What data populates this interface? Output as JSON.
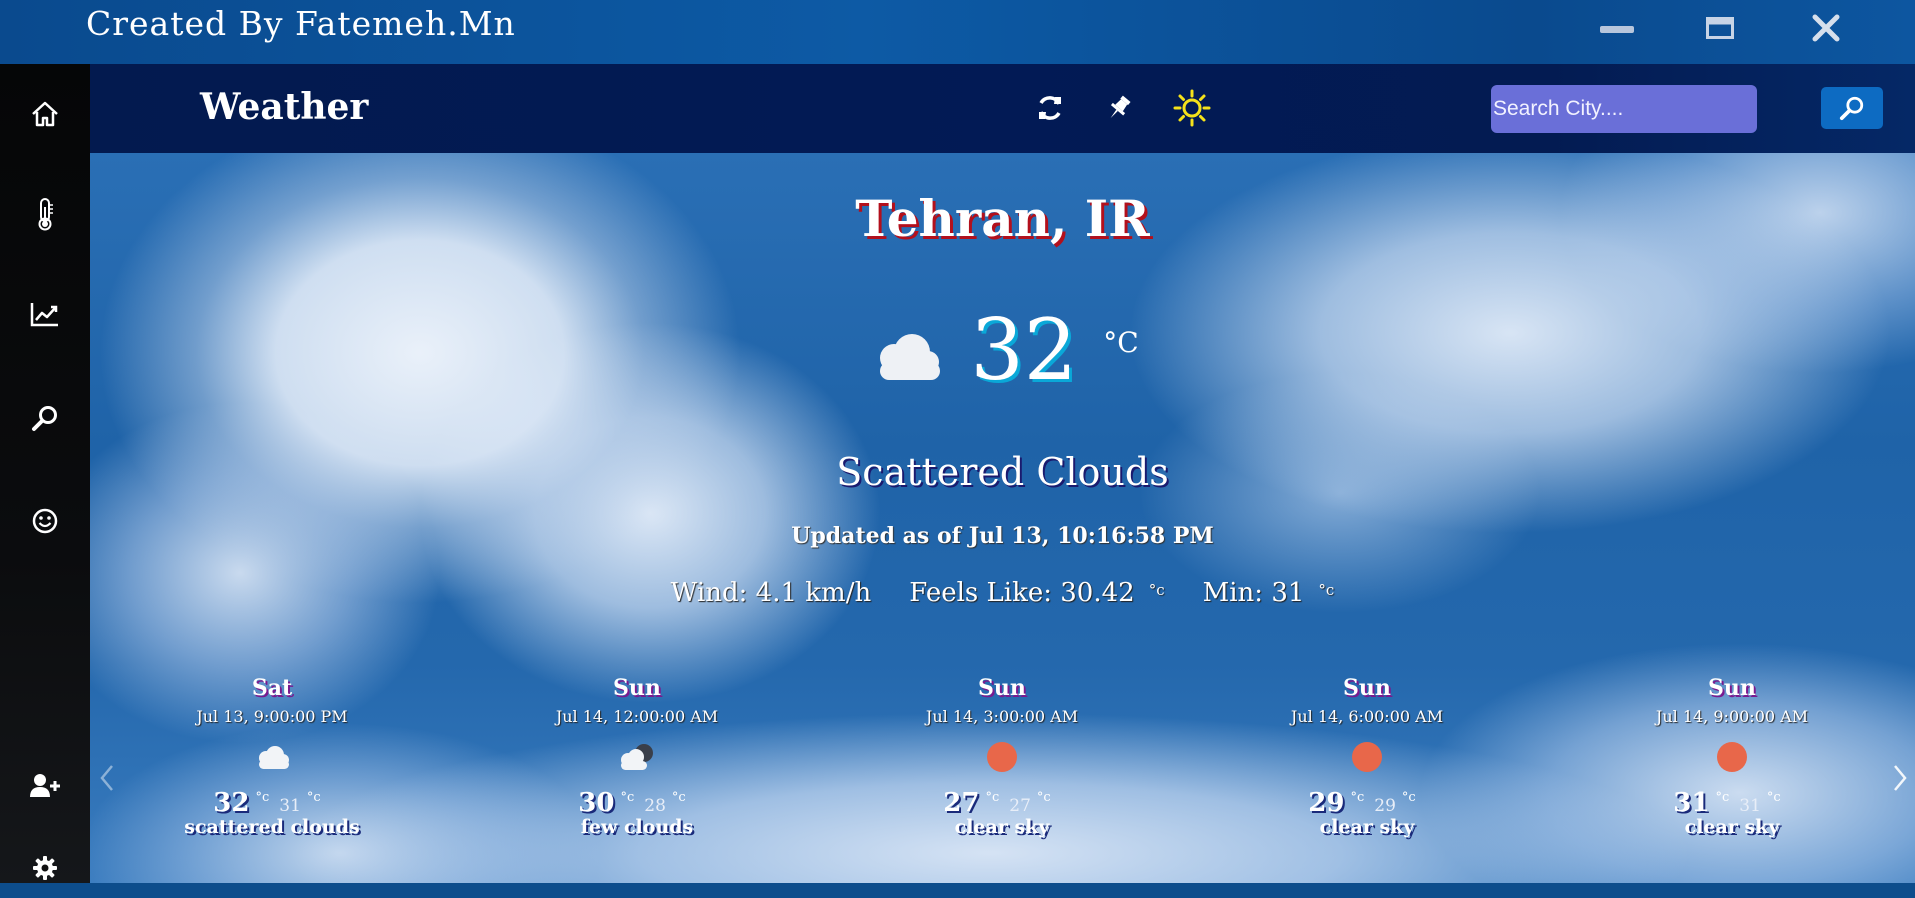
{
  "titlebar": {
    "title": "Created By Fatemeh.Mn",
    "buttons": [
      {
        "icon": "minimize-icon"
      },
      {
        "icon": "maximize-icon"
      },
      {
        "icon": "close-icon"
      }
    ]
  },
  "sidebar": {
    "items": [
      {
        "icon": "home-icon"
      },
      {
        "icon": "thermometer-icon"
      },
      {
        "icon": "chart-line-icon"
      },
      {
        "icon": "search-icon"
      },
      {
        "icon": "smile-icon"
      },
      {
        "icon": "user-plus-icon"
      },
      {
        "icon": "gear-icon"
      }
    ]
  },
  "header": {
    "brand": "Weather",
    "icons": [
      "refresh-icon",
      "pin-icon",
      "sun-icon"
    ],
    "search_placeholder": "Search City....",
    "search_button_icon": "search-icon",
    "colors": {
      "sun": "#f5e21a",
      "search_bg": "#6a6fd8",
      "search_button": "#0d6bc2"
    }
  },
  "current": {
    "city": "Tehran, IR",
    "temp": "32",
    "temp_unit": "°C",
    "icon": "cloud-icon",
    "description": "Scattered Clouds",
    "updated": "Updated as of Jul 13, 10:16:58 PM",
    "wind_label": "Wind: 4.1 km/h",
    "feels_label": "Feels Like: 30.42",
    "feels_unit": "°c",
    "min_label": "Min: 31",
    "min_unit": "°c"
  },
  "forecast": [
    {
      "day": "Sat",
      "date": "Jul 13, 9:00:00 PM",
      "icon": "cloud-icon",
      "tmax": "32",
      "tmin": "31",
      "unit": "°c",
      "desc": "scattered clouds"
    },
    {
      "day": "Sun",
      "date": "Jul 14, 12:00:00 AM",
      "icon": "cloud-moon-icon",
      "tmax": "30",
      "tmin": "28",
      "unit": "°c",
      "desc": "few clouds"
    },
    {
      "day": "Sun",
      "date": "Jul 14, 3:00:00 AM",
      "icon": "moon-icon",
      "tmax": "27",
      "tmin": "27",
      "unit": "°c",
      "desc": "clear sky"
    },
    {
      "day": "Sun",
      "date": "Jul 14, 6:00:00 AM",
      "icon": "sun-icon",
      "tmax": "29",
      "tmin": "29",
      "unit": "°c",
      "desc": "clear sky"
    },
    {
      "day": "Sun",
      "date": "Jul 14, 9:00:00 AM",
      "icon": "sun-icon",
      "tmax": "31",
      "tmin": "31",
      "unit": "°c",
      "desc": "clear sky"
    }
  ],
  "carousel": {
    "prev_icon": "chevron-left-icon",
    "next_icon": "chevron-right-icon"
  }
}
